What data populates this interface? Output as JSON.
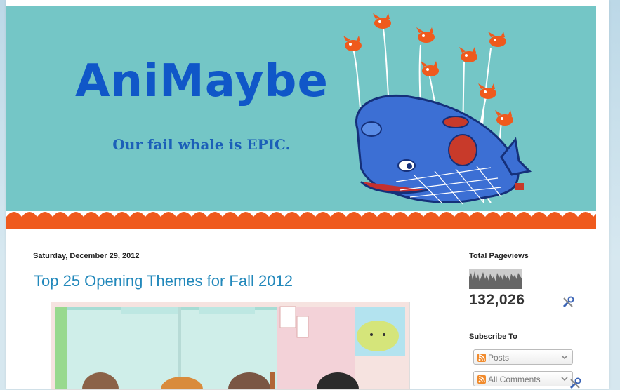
{
  "header": {
    "title": "AniMaybe",
    "tagline": "Our fail whale is EPIC."
  },
  "post": {
    "date": "Saturday, December 29, 2012",
    "title": "Top 25 Opening Themes for Fall 2012"
  },
  "sidebar": {
    "pageviews": {
      "title": "Total Pageviews",
      "count": "132,026"
    },
    "subscribe": {
      "title": "Subscribe To",
      "options": [
        "Posts",
        "All Comments"
      ]
    }
  },
  "colors": {
    "header_bg": "#74c6c6",
    "title_blue": "#1057c8",
    "wave_orange": "#ef5a1d",
    "link_blue": "#2288bb"
  },
  "icons": [
    "wrench-icon",
    "feed-icon",
    "chevron-down-icon"
  ]
}
